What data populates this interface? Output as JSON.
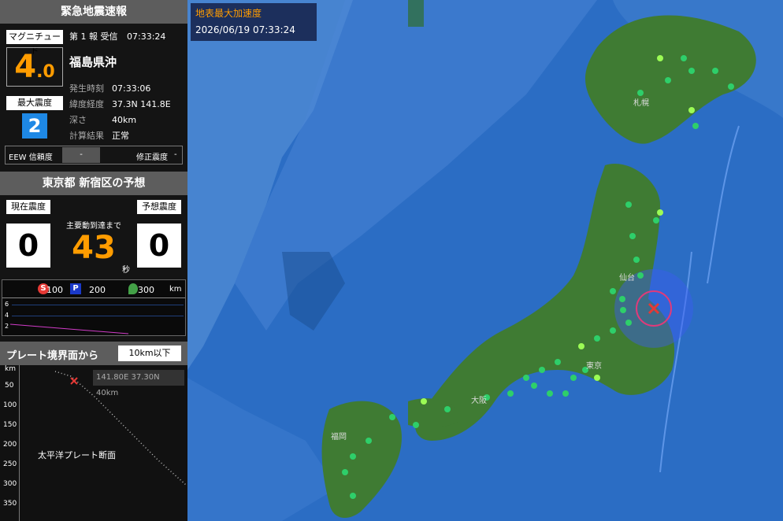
{
  "eew": {
    "title": "緊急地震速報",
    "mag_label": "マグニチュード",
    "report": "第 1 報 受信",
    "report_time": "07:33:24",
    "mag_int": "4",
    "mag_dec": ".0",
    "region": "福島県沖",
    "max_int_label": "最大震度",
    "max_int": "2",
    "occ_time_label": "発生時刻",
    "occ_time": "07:33:06",
    "latlon_label": "緯度経度",
    "latlon": "37.3N 141.8E",
    "depth_label": "深さ",
    "depth": "40km",
    "calc_label": "計算結果",
    "calc": "正常",
    "conf_label": "EEW 信頼度",
    "conf_value": "-",
    "corr_label": "修正震度",
    "corr_value": "-"
  },
  "forecast": {
    "title": "東京都 新宿区の予想",
    "cur_label": "現在震度",
    "pred_label": "予想震度",
    "cur_val": "0",
    "pred_val": "0",
    "arrival_label": "主要動到達まで",
    "arrival_val": "43",
    "sec": "秒",
    "dist_S": "S",
    "dist_S_val": "100",
    "dist_P": "P",
    "dist_P_val": "200",
    "dist_pin_val": "300",
    "km": "km",
    "y_ticks": [
      "6",
      "4",
      "2"
    ]
  },
  "plate": {
    "title": "プレート境界面から",
    "filter": "10km以下",
    "km": "km",
    "depth_ticks": [
      "50",
      "100",
      "150",
      "200",
      "250",
      "300",
      "350"
    ],
    "coord": "141.80E 37.30N  40km",
    "label": "太平洋プレート断面"
  },
  "map": {
    "title": "地表最大加速度",
    "datetime": "2026/06/19 07:33:24",
    "cities": [
      "札幌",
      "仙台",
      "東京",
      "大阪",
      "福岡"
    ]
  },
  "colors": {
    "accent": "#ff9c00",
    "int2": "#1e88e5",
    "panel": "#5d5d5d"
  }
}
